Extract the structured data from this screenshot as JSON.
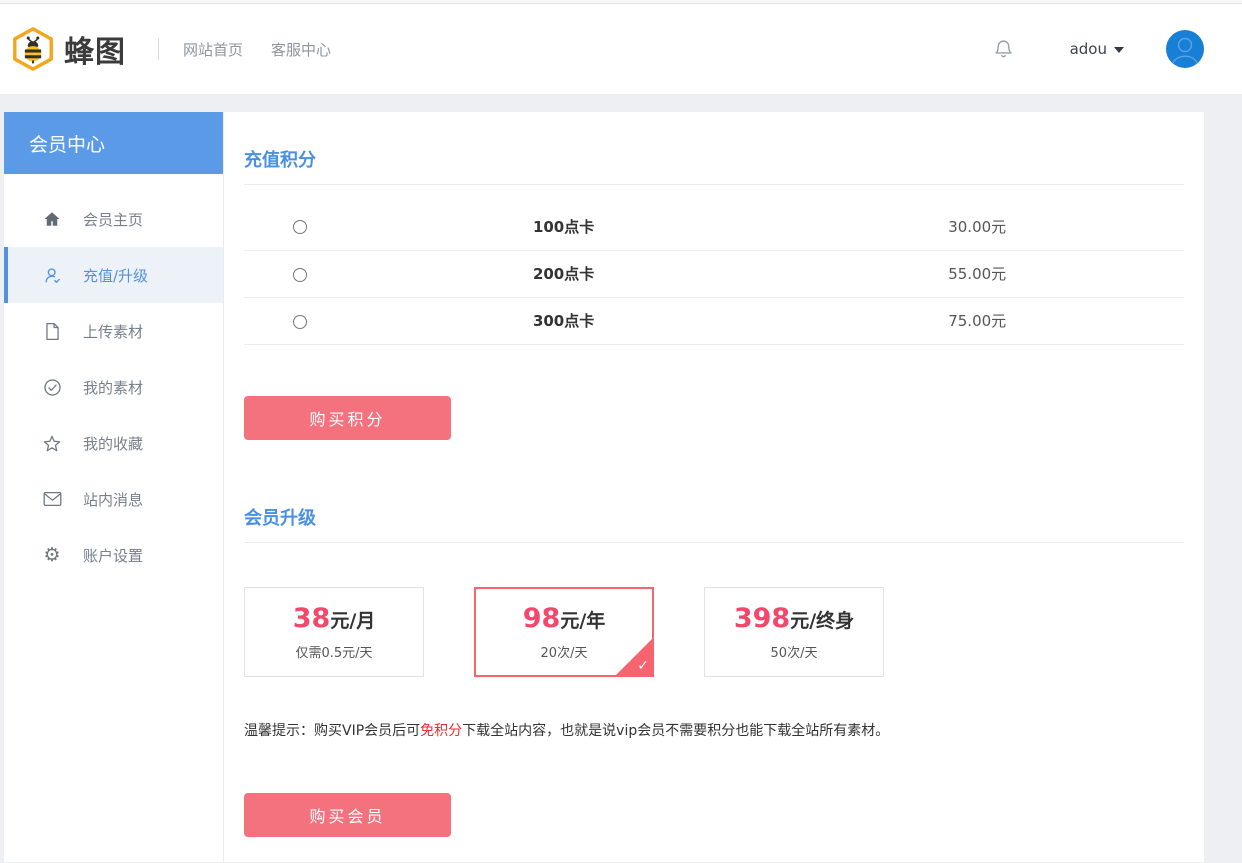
{
  "header": {
    "logo_text": "蜂图",
    "nav": [
      {
        "label": "网站首页"
      },
      {
        "label": "客服中心"
      }
    ],
    "username": "adou"
  },
  "sidebar": {
    "title": "会员中心",
    "items": [
      {
        "label": "会员主页",
        "icon": "home-icon",
        "active": false
      },
      {
        "label": "充值/升级",
        "icon": "user-icon",
        "active": true
      },
      {
        "label": "上传素材",
        "icon": "file-icon",
        "active": false
      },
      {
        "label": "我的素材",
        "icon": "check-circle-icon",
        "active": false
      },
      {
        "label": "我的收藏",
        "icon": "star-icon",
        "active": false
      },
      {
        "label": "站内消息",
        "icon": "mail-icon",
        "active": false
      },
      {
        "label": "账户设置",
        "icon": "gear-icon",
        "active": false
      }
    ]
  },
  "recharge": {
    "title": "充值积分",
    "rows": [
      {
        "name": "100点卡",
        "price": "30.00元"
      },
      {
        "name": "200点卡",
        "price": "55.00元"
      },
      {
        "name": "300点卡",
        "price": "75.00元"
      }
    ],
    "buy_button": "购买积分"
  },
  "upgrade": {
    "title": "会员升级",
    "plans": [
      {
        "price": "38",
        "unit": "元/月",
        "desc": "仅需0.5元/天",
        "selected": false
      },
      {
        "price": "98",
        "unit": "元/年",
        "desc": "20次/天",
        "selected": true
      },
      {
        "price": "398",
        "unit": "元/终身",
        "desc": "50次/天",
        "selected": false
      }
    ],
    "tip_prefix": "温馨提示：购买VIP会员后可",
    "tip_highlight": "免积分",
    "tip_suffix": "下载全站内容，也就是说vip会员不需要积分也能下载全站所有素材。",
    "buy_button": "购买会员"
  },
  "colors": {
    "accent_blue": "#4a90e2",
    "sidebar_header_blue": "#5b9ae6",
    "button_pink": "#f4727d",
    "plan_number_pink": "#f4476b",
    "selected_border_pink": "#f5646f",
    "tip_red": "#f02c2c",
    "avatar_blue": "#187fd6"
  }
}
